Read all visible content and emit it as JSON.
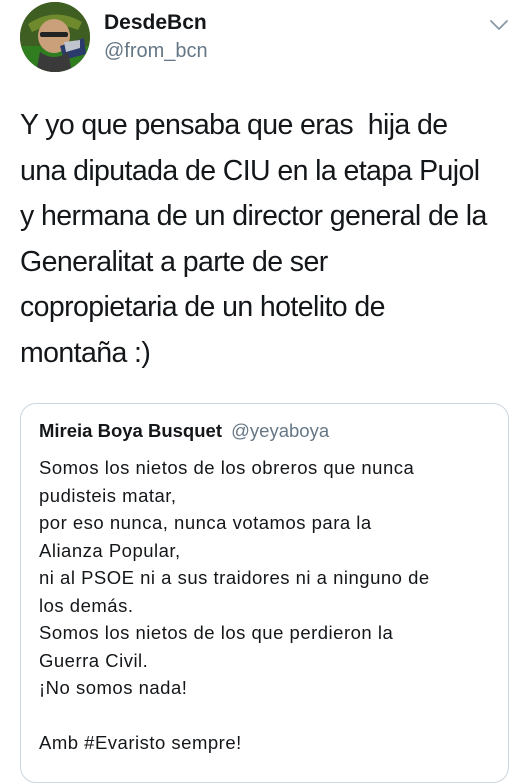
{
  "author": {
    "display_name": "DesdeBcn",
    "handle": "@from_bcn",
    "avatar_icon": "profile-photo"
  },
  "menu": {
    "icon": "chevron-down-icon"
  },
  "tweet": {
    "text": "Y yo que pensaba que eras  hija de\nuna diputada de CIU en la etapa Pujol\ny hermana de un director general de la\nGeneralitat a parte de ser\ncopropietaria de un hotelito de\nmontaña :)"
  },
  "quoted_tweet": {
    "display_name": "Mireia Boya Busquet",
    "handle": "@yeyaboya",
    "text": "Somos los nietos de los obreros que nunca\npudisteis matar,\npor eso nunca, nunca votamos para la\nAlianza Popular,\nni al PSOE ni a sus traidores ni a ninguno de\nlos demás.\nSomos los nietos de los que perdieron la\nGuerra Civil.\n¡No somos nada!\n\nAmb #Evaristo sempre!"
  },
  "colors": {
    "primary_text": "#14171a",
    "secondary_text": "#657786",
    "border": "#ccd6dd",
    "background": "#ffffff"
  }
}
